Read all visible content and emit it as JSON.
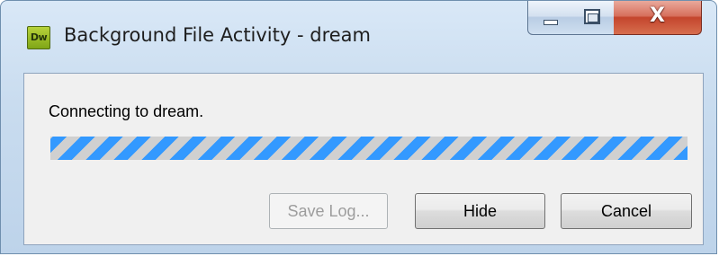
{
  "window": {
    "title": "Background File Activity - dream",
    "app_icon_label": "Dw",
    "app_icon_color": "#8cb021",
    "controls": {
      "minimize": "minimize-icon",
      "maximize": "maximize-icon",
      "close": "close-icon",
      "close_glyph": "X"
    }
  },
  "dialog": {
    "status_text": "Connecting to dream.",
    "progress": {
      "mode": "indeterminate",
      "stripe_color": "#3399ff",
      "track_color": "#d0d0d0"
    },
    "buttons": {
      "save_log": {
        "label": "Save Log...",
        "enabled": false
      },
      "hide": {
        "label": "Hide",
        "enabled": true
      },
      "cancel": {
        "label": "Cancel",
        "enabled": true
      }
    }
  }
}
